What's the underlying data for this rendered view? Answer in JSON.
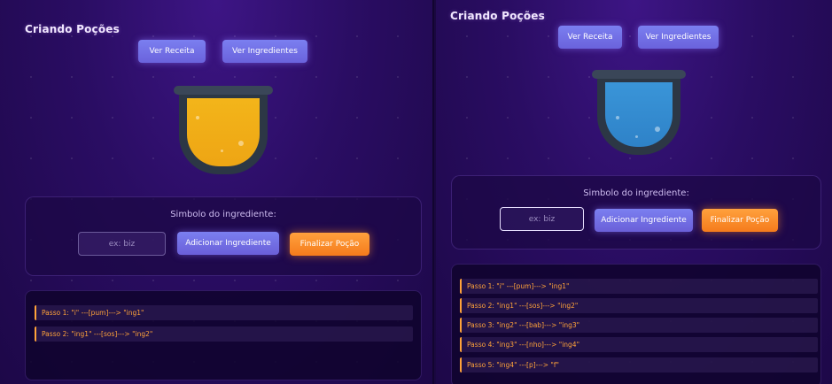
{
  "colors": {
    "accent_orange": "#ffa33a",
    "button_purple": "#6a62dc",
    "background": "#2a0d63",
    "liquid_yellow": "#f3b51a",
    "liquid_blue": "#3a95d8"
  },
  "left": {
    "title": "Criando Poções",
    "nav": {
      "recipe_label": "Ver Receita",
      "ingredients_label": "Ver Ingredientes"
    },
    "controls": {
      "label": "Simbolo do ingrediente:",
      "input_placeholder": "ex: biz",
      "add_label": "Adicionar Ingrediente",
      "finish_label": "Finalizar Poção"
    },
    "steps": [
      "Passo 1: \"i\" ---[pum]---> \"ing1\"",
      "Passo 2: \"ing1\" ---[sos]---> \"ing2\""
    ]
  },
  "right": {
    "title": "Criando Poções",
    "nav": {
      "recipe_label": "Ver Receita",
      "ingredients_label": "Ver Ingredientes"
    },
    "controls": {
      "label": "Simbolo do ingrediente:",
      "input_placeholder": "ex: biz",
      "add_label": "Adicionar Ingrediente",
      "finish_label": "Finalizar Poção"
    },
    "steps": [
      "Passo 1: \"i\" ---[pum]---> \"ing1\"",
      "Passo 2: \"ing1\" ---[sos]---> \"ing2\"",
      "Passo 3: \"ing2\" ---[bab]---> \"ing3\"",
      "Passo 4: \"ing3\" ---[nho]---> \"ing4\"",
      "Passo 5: \"ing4\" ---[p]---> \"f\""
    ]
  }
}
